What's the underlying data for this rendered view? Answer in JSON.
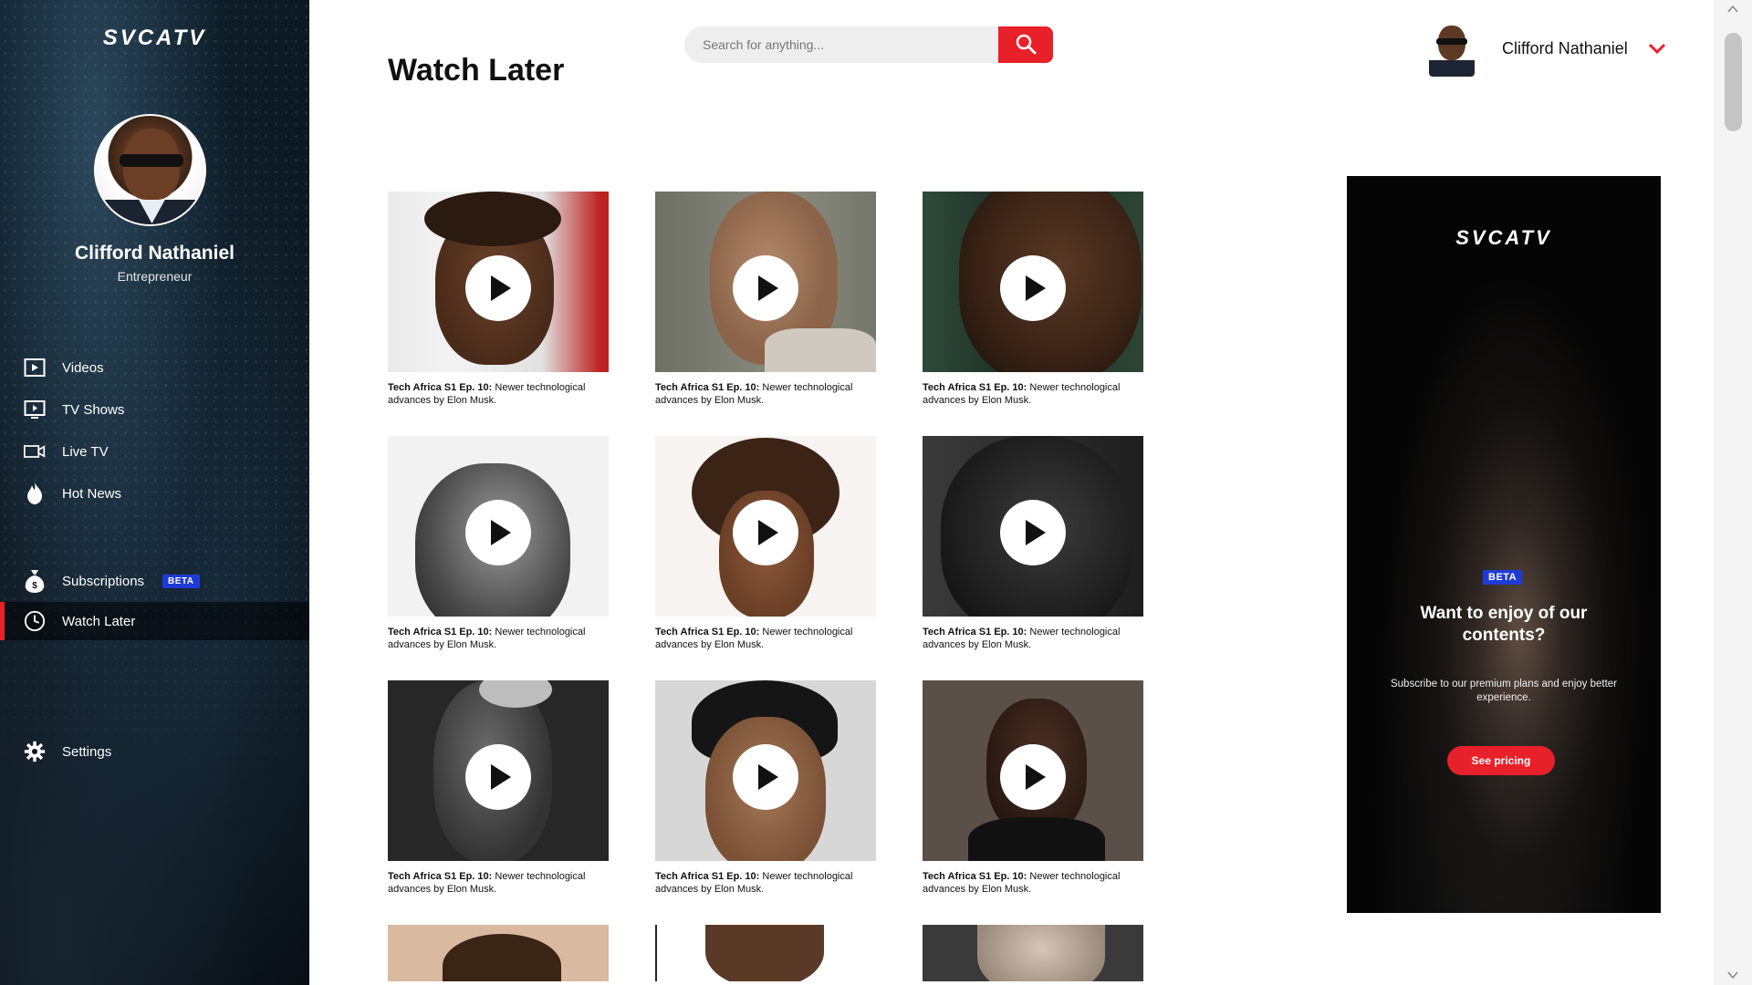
{
  "brand": {
    "logo": "SVCATV"
  },
  "sidebar": {
    "profile_name": "Clifford Nathaniel",
    "profile_role": "Entrepreneur",
    "nav_primary": [
      {
        "label": "Videos",
        "icon": "video-icon"
      },
      {
        "label": "TV Shows",
        "icon": "tv-icon"
      },
      {
        "label": "Live TV",
        "icon": "camera-icon"
      },
      {
        "label": "Hot News",
        "icon": "flame-icon"
      }
    ],
    "nav_secondary": [
      {
        "label": "Subscriptions",
        "icon": "money-bag-icon",
        "badge": "BETA"
      },
      {
        "label": "Watch Later",
        "icon": "clock-icon",
        "active": true
      }
    ],
    "settings_label": "Settings"
  },
  "header": {
    "page_title": "Watch Later",
    "search_placeholder": "Search for anything...",
    "user_name": "Clifford Nathaniel"
  },
  "videos": [
    {
      "title_bold": "Tech Africa S1 Ep. 10:",
      "title_rest": " Newer technological advances by Elon Musk."
    },
    {
      "title_bold": "Tech Africa S1 Ep. 10:",
      "title_rest": " Newer technological advances by Elon Musk."
    },
    {
      "title_bold": "Tech Africa S1 Ep. 10:",
      "title_rest": " Newer technological advances by Elon Musk."
    },
    {
      "title_bold": "Tech Africa S1 Ep. 10:",
      "title_rest": " Newer technological advances by Elon Musk."
    },
    {
      "title_bold": "Tech Africa S1 Ep. 10:",
      "title_rest": " Newer technological advances by Elon Musk."
    },
    {
      "title_bold": "Tech Africa S1 Ep. 10:",
      "title_rest": " Newer technological advances by Elon Musk."
    },
    {
      "title_bold": "Tech Africa S1 Ep. 10:",
      "title_rest": " Newer technological advances by Elon Musk."
    },
    {
      "title_bold": "Tech Africa S1 Ep. 10:",
      "title_rest": " Newer technological advances by Elon Musk."
    },
    {
      "title_bold": "Tech Africa S1 Ep. 10:",
      "title_rest": " Newer technological advances by Elon Musk."
    }
  ],
  "ad": {
    "logo": "SVCATV",
    "badge": "BETA",
    "headline": "Want to enjoy of our contents?",
    "subtext": "Subscribe to our premium plans and enjoy better experience.",
    "cta": "See pricing"
  },
  "colors": {
    "accent": "#e8202a",
    "beta": "#1f3bd6",
    "sidebar_bg": "#0a141b"
  }
}
